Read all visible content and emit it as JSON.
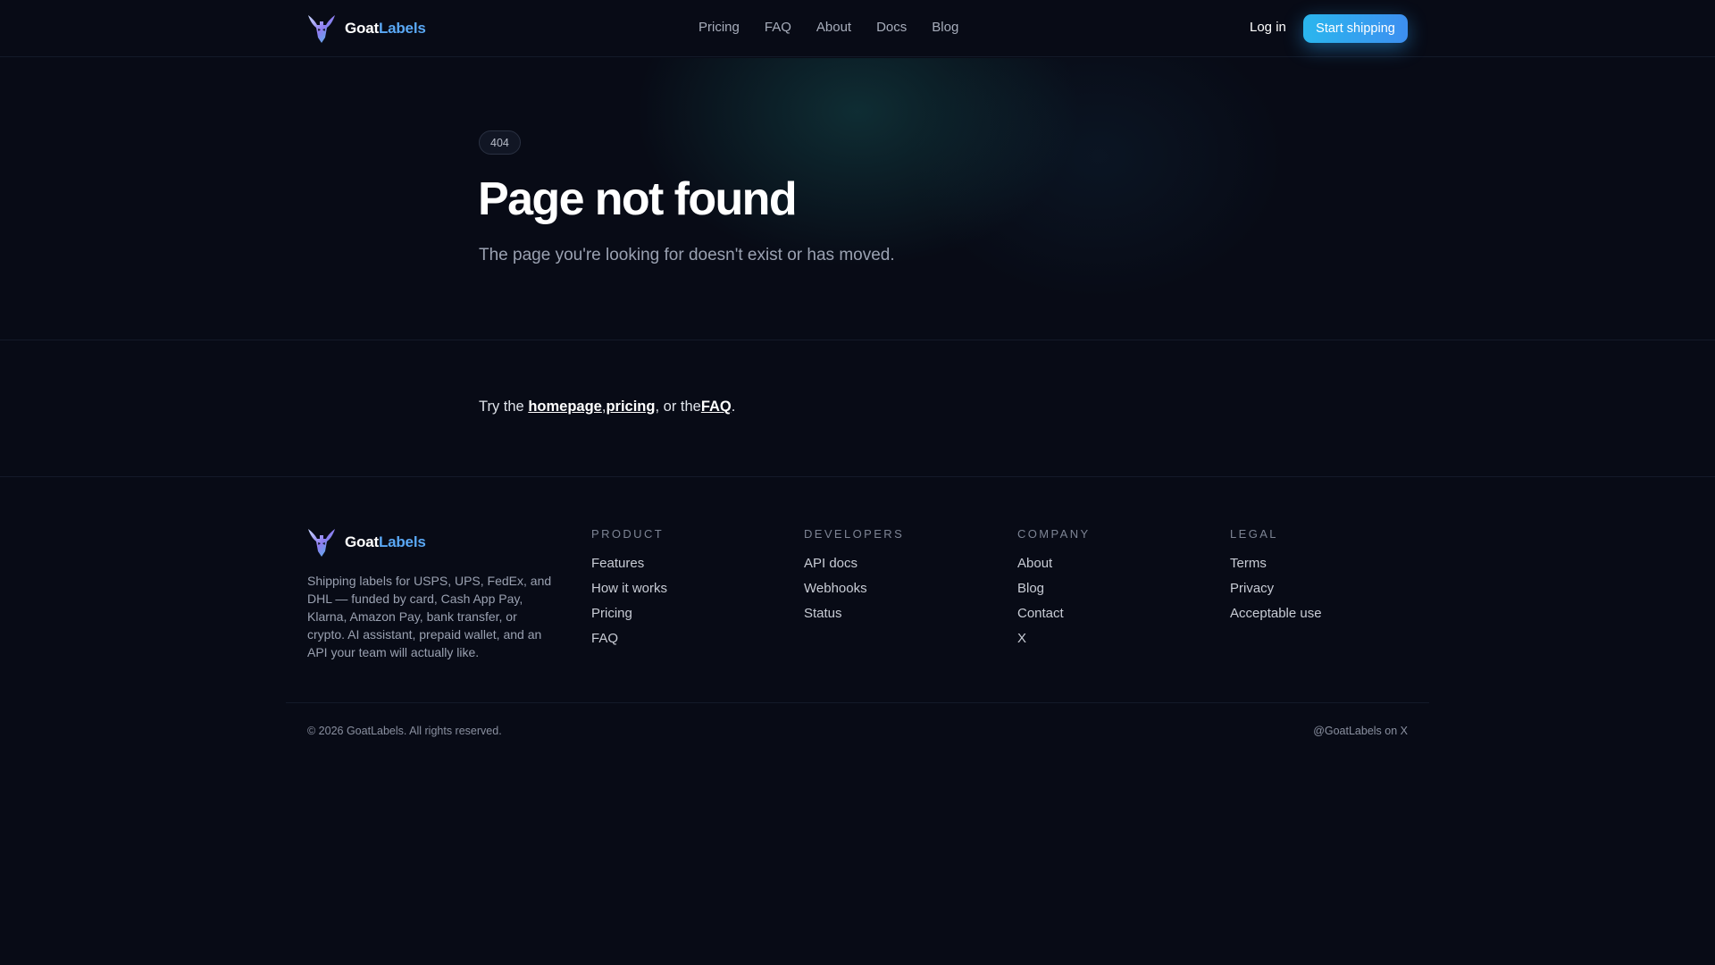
{
  "brand": {
    "name_part1": "Goat",
    "name_part2": "Labels",
    "logo_icon": "goat-head-logo"
  },
  "colors": {
    "background": "#080b16",
    "accent_blue": "#5aa8f5",
    "cta_gradient_start": "#2ab6ee",
    "cta_gradient_end": "#3d8ff0"
  },
  "nav": {
    "items": [
      "Pricing",
      "FAQ",
      "About",
      "Docs",
      "Blog"
    ],
    "login_label": "Log in",
    "cta_label": "Start shipping"
  },
  "hero": {
    "badge": "404",
    "title": "Page not found",
    "subtitle": "The page you're looking for doesn't exist or has moved."
  },
  "suggest": {
    "prefix": "Try the ",
    "link_homepage": "homepage",
    "sep1": ",",
    "link_pricing": "pricing",
    "sep2": ", or the",
    "link_faq": "FAQ",
    "suffix": "."
  },
  "footer": {
    "description": "Shipping labels for USPS, UPS, FedEx, and DHL — funded by card, Cash App Pay, Klarna, Amazon Pay, bank transfer, or crypto. AI assistant, prepaid wallet, and an API your team will actually like.",
    "columns": [
      {
        "heading": "PRODUCT",
        "links": [
          "Features",
          "How it works",
          "Pricing",
          "FAQ"
        ]
      },
      {
        "heading": "DEVELOPERS",
        "links": [
          "API docs",
          "Webhooks",
          "Status"
        ]
      },
      {
        "heading": "COMPANY",
        "links": [
          "About",
          "Blog",
          "Contact",
          "X"
        ]
      },
      {
        "heading": "LEGAL",
        "links": [
          "Terms",
          "Privacy",
          "Acceptable use"
        ]
      }
    ],
    "copyright": "© 2026 GoatLabels. All rights reserved.",
    "social": "@GoatLabels on X"
  }
}
